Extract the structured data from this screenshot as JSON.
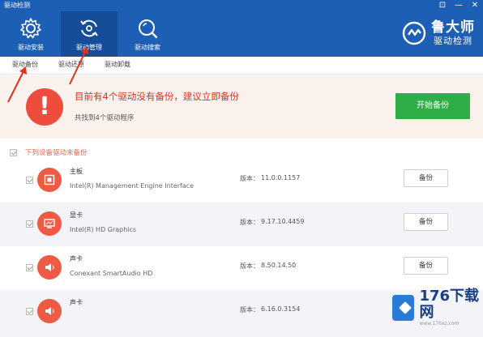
{
  "window": {
    "title": "驱动检测",
    "controls": [
      "⊡",
      "—",
      "✕"
    ]
  },
  "nav": [
    {
      "label": "驱动安装",
      "icon": "gear-icon",
      "active": false
    },
    {
      "label": "驱动管理",
      "icon": "refresh-icon",
      "active": true
    },
    {
      "label": "驱动搜索",
      "icon": "search-icon",
      "active": false
    }
  ],
  "brand": {
    "name": "鲁大师",
    "sub": "驱动检测"
  },
  "subtabs": [
    "驱动备份",
    "驱动还原",
    "驱动卸载"
  ],
  "banner": {
    "title": "目前有4个驱动没有备份，建议立即备份",
    "subtitle": "共找到4个驱动程序",
    "button": "开始备份"
  },
  "group_label": "下列设备驱动未备份",
  "version_label": "版本：",
  "backup_label": "备份",
  "drivers": [
    {
      "category": "主板",
      "name": "Intel(R) Management Engine Interface",
      "version": "11.0.0.1157",
      "icon": "motherboard-icon"
    },
    {
      "category": "显卡",
      "name": "Intel(R) HD Graphics",
      "version": "9.17.10.4459",
      "icon": "display-card-icon"
    },
    {
      "category": "声卡",
      "name": "Conexant SmartAudio HD",
      "version": "8.50.14.50",
      "icon": "speaker-icon"
    },
    {
      "category": "声卡",
      "name": "",
      "version": "6.16.0.3154",
      "icon": "speaker-icon"
    }
  ],
  "watermark": {
    "main": "176下载网",
    "url": "www.176xz.com"
  },
  "colors": {
    "header": "#1d5fb5",
    "accent_red": "#ee4c3c",
    "button_green": "#2fae48"
  }
}
